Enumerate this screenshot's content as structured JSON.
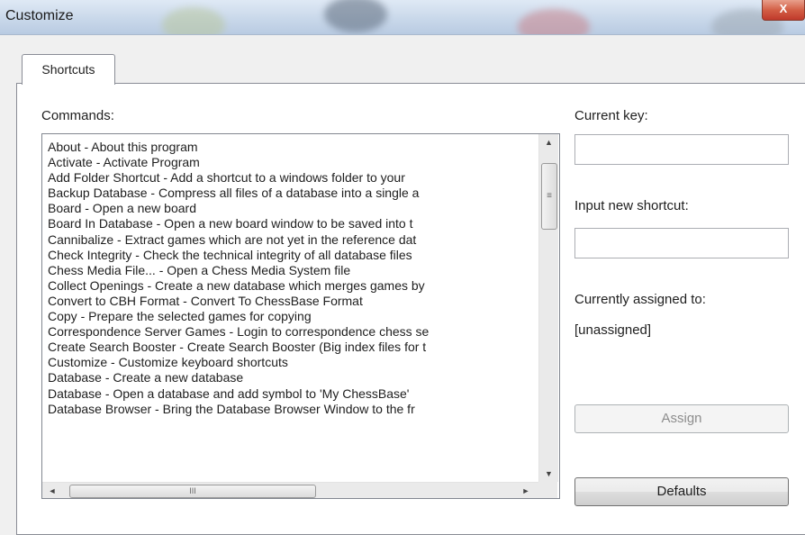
{
  "window": {
    "title": "Customize",
    "close_label": "X"
  },
  "tabs": [
    {
      "label": "Shortcuts",
      "active": true
    }
  ],
  "commands": {
    "label": "Commands:",
    "items": [
      "About - About this program",
      "Activate - Activate Program",
      "Add Folder Shortcut - Add a shortcut to a windows folder to your",
      "Backup Database - Compress all files of a database into a single a",
      "Board - Open a new board",
      "Board In Database - Open a new board window to be saved into t",
      "Cannibalize - Extract games which are not yet in the reference dat",
      "Check Integrity - Check the technical integrity of all database files",
      "Chess Media File... - Open a Chess Media System file",
      "Collect Openings - Create a new database which merges games by",
      "Convert to CBH Format - Convert To ChessBase Format",
      "Copy - Prepare the selected games for copying",
      "Correspondence Server Games - Login to correspondence chess se",
      "Create Search Booster - Create Search Booster (Big index files for t",
      "Customize - Customize keyboard shortcuts",
      "Database - Create a new database",
      "Database - Open a database and add symbol to 'My ChessBase'",
      "Database Browser - Bring the Database Browser Window to the fr"
    ],
    "scroll_up_glyph": "▲",
    "scroll_down_glyph": "▼",
    "scroll_left_glyph": "◄",
    "scroll_right_glyph": "►",
    "vthumb_grip": "≡",
    "hthumb_grip": "III"
  },
  "current_key": {
    "label": "Current key:",
    "value": ""
  },
  "new_shortcut": {
    "label": "Input new shortcut:",
    "value": ""
  },
  "assigned": {
    "label": "Currently assigned to:",
    "value": "[unassigned]"
  },
  "buttons": {
    "assign": "Assign",
    "defaults": "Defaults"
  }
}
